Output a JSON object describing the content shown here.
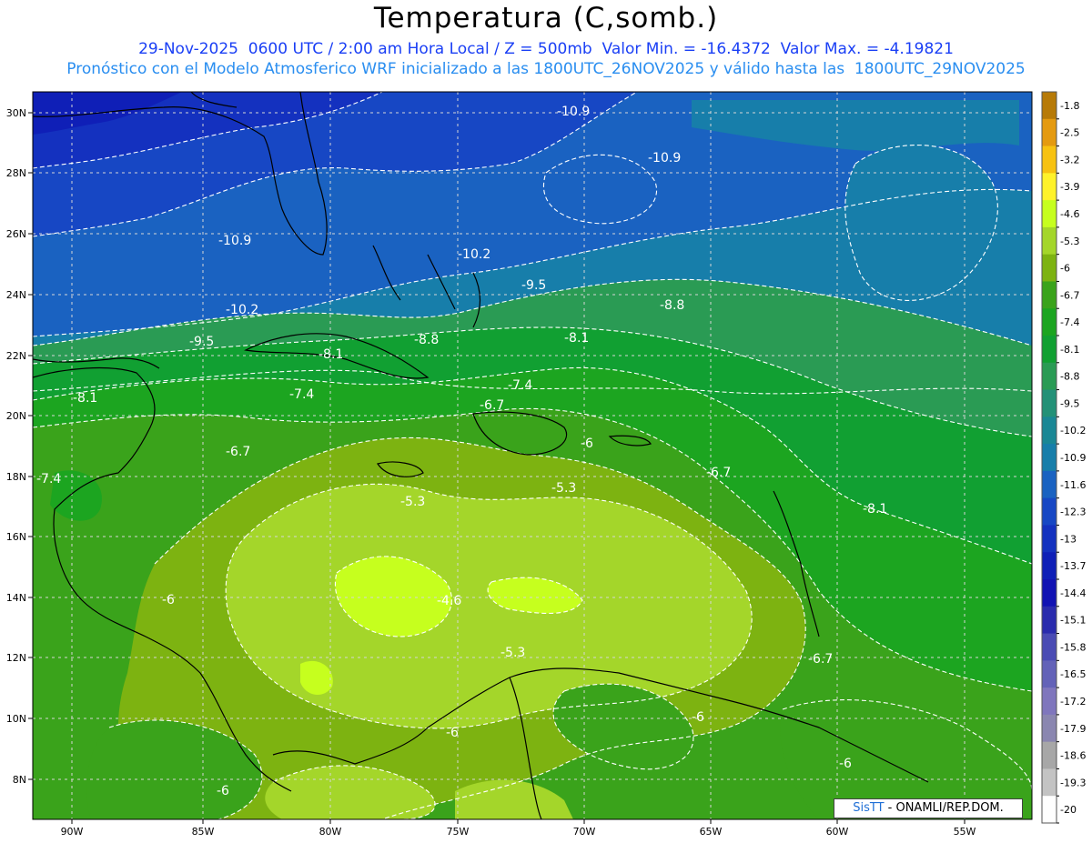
{
  "header": {
    "title": "Temperatura (C,somb.)",
    "line1": "29-Nov-2025  0600 UTC / 2:00 am Hora Local / Z = 500mb  Valor Min. = -16.4372  Valor Max. = -4.19821",
    "line2": "Pronóstico con el Modelo Atmosferico WRF inicializado a las 1800UTC_26NOV2025 y válido hasta las  1800UTC_29NOV2025"
  },
  "axes": {
    "lat_labels": [
      "30N",
      "28N",
      "26N",
      "24N",
      "22N",
      "20N",
      "18N",
      "16N",
      "14N",
      "12N",
      "10N",
      "8N"
    ],
    "lon_labels": [
      "90W",
      "85W",
      "80W",
      "75W",
      "70W",
      "65W",
      "60W",
      "55W"
    ]
  },
  "colorbar": {
    "labels": [
      "-1.8",
      "-2.5",
      "-3.2",
      "-3.9",
      "-4.6",
      "-5.3",
      "-6",
      "-6.7",
      "-7.4",
      "-8.1",
      "-8.8",
      "-9.5",
      "-10.2",
      "-10.9",
      "-11.6",
      "-12.3",
      "-13",
      "-13.7",
      "-14.4",
      "-15.1",
      "-15.8",
      "-16.5",
      "-17.2",
      "-17.9",
      "-18.6",
      "-19.3",
      "-20"
    ],
    "colors": [
      "#b77a07",
      "#e49a10",
      "#f7c211",
      "#fff22a",
      "#c6ff1e",
      "#a4d62a",
      "#7db311",
      "#3aa31b",
      "#1ca520",
      "#11a032",
      "#2a9b54",
      "#239177",
      "#1a8795",
      "#177eaa",
      "#1a62c1",
      "#1747c4",
      "#1431bf",
      "#0f1fb7",
      "#1112b3",
      "#2a2bad",
      "#4a4bb4",
      "#6362b8",
      "#7f76bd",
      "#8a86b0",
      "#a7a7a7",
      "#c3c3c3",
      "#ffffff"
    ]
  },
  "contour_labels": [
    {
      "text": "-10.9"
    },
    {
      "text": "-10.9"
    },
    {
      "text": "-10.9"
    },
    {
      "text": "-10.2"
    },
    {
      "text": "-10.2"
    },
    {
      "text": "-9.5"
    },
    {
      "text": "-9.5"
    },
    {
      "text": "-8.8"
    },
    {
      "text": "-8.8"
    },
    {
      "text": "-8.1"
    },
    {
      "text": "-8.1"
    },
    {
      "text": "-8.1"
    },
    {
      "text": "-8.1"
    },
    {
      "text": "-7.4"
    },
    {
      "text": "-7.4"
    },
    {
      "text": "-7.4"
    },
    {
      "text": "-6.7"
    },
    {
      "text": "-6.7"
    },
    {
      "text": "-6.7"
    },
    {
      "text": "-6.7"
    },
    {
      "text": "-6"
    },
    {
      "text": "-6"
    },
    {
      "text": "-6"
    },
    {
      "text": "-6"
    },
    {
      "text": "-6"
    },
    {
      "text": "-6"
    },
    {
      "text": "-5.3"
    },
    {
      "text": "-5.3"
    },
    {
      "text": "-5.3"
    },
    {
      "text": "-4.6"
    }
  ],
  "attribution": {
    "brand": "SisTT",
    "org": " - ONAMLI/REP.DOM."
  }
}
